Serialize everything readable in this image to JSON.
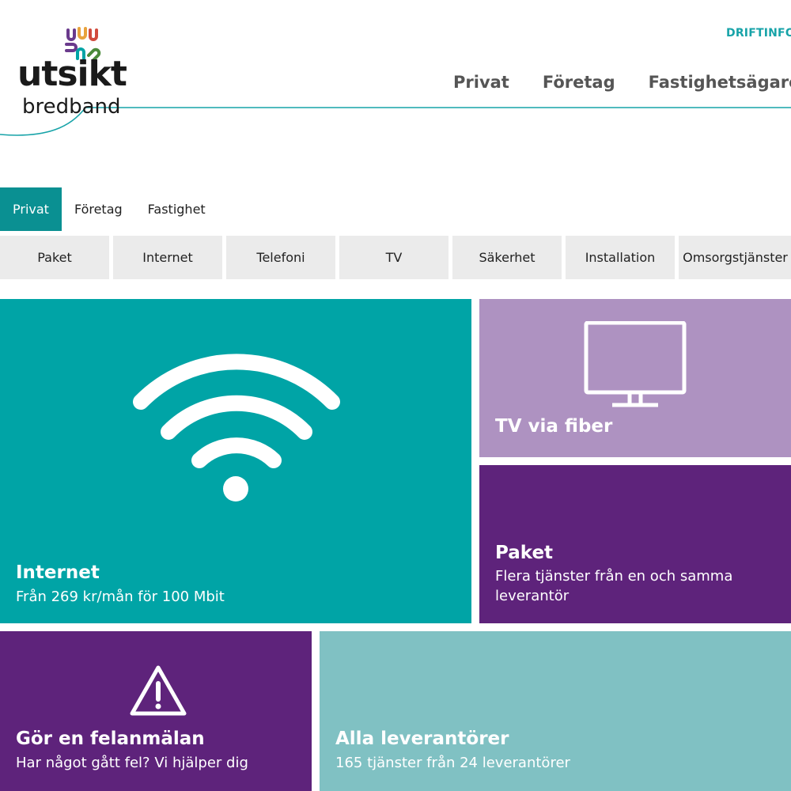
{
  "brand": {
    "name": "utsikt",
    "sub": "bredband",
    "colors": [
      "#6a3a8c",
      "#00a4a6",
      "#e8a23c",
      "#d14b3d",
      "#4a8a3a"
    ]
  },
  "header": {
    "top_link": "DRIFTINFOR",
    "nav": [
      "Privat",
      "Företag",
      "Fastighetsägare och BF"
    ]
  },
  "segments": {
    "items": [
      "Privat",
      "Företag",
      "Fastighet"
    ],
    "active": "Privat"
  },
  "categories": [
    "Paket",
    "Internet",
    "Telefoni",
    "TV",
    "Säkerhet",
    "Installation",
    "Omsorgstjänster"
  ],
  "tiles": {
    "internet": {
      "title": "Internet",
      "subtitle": "Från 269 kr/mån för 100 Mbit",
      "icon": "wifi-icon",
      "color": "#00a4a6"
    },
    "tv": {
      "title": "TV via fiber",
      "icon": "tv-icon",
      "color": "#ae92c1"
    },
    "paket": {
      "title": "Paket",
      "subtitle": "Flera tjänster från en och samma leverantör",
      "color": "#5e237b"
    },
    "fel": {
      "title": "Gör en felanmälan",
      "subtitle": "Har något gått fel? Vi hjälper dig",
      "icon": "warning-icon",
      "color": "#5e237b"
    },
    "leverantorer": {
      "title": "Alla leverantörer",
      "subtitle": "165 tjänster från 24 leverantörer",
      "color": "#80c1c3"
    }
  }
}
